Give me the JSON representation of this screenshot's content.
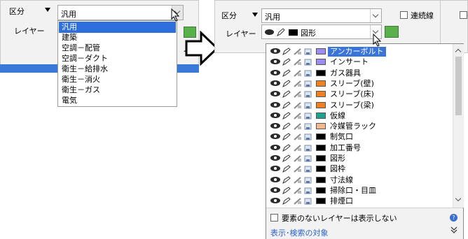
{
  "left": {
    "category_label": "区分",
    "layer_label": "レイヤー",
    "category_value": "汎用",
    "category_options": [
      "汎用",
      "建築",
      "空調－配管",
      "空調－ダクト",
      "衛生－給排水",
      "衛生－消火",
      "衛生－ガス",
      "電気"
    ],
    "selected_index": 0
  },
  "right": {
    "category_label": "区分",
    "category_value": "汎用",
    "layer_label": "レイヤー",
    "layer_value": "図形",
    "continuous_line_label": "連続線",
    "layers": [
      {
        "name": "アンカーボルト",
        "color": "#9b8ef0",
        "selected": true
      },
      {
        "name": "インサート",
        "color": "#9b8ef0",
        "selected": false
      },
      {
        "name": "ガス器具",
        "color": "#000000",
        "selected": false
      },
      {
        "name": "スリーブ(壁)",
        "color": "#f08020",
        "selected": false
      },
      {
        "name": "スリーブ(床)",
        "color": "#f08020",
        "selected": false
      },
      {
        "name": "スリーブ(梁)",
        "color": "#f08020",
        "selected": false
      },
      {
        "name": "仮線",
        "color": "#20a090",
        "selected": false
      },
      {
        "name": "冷媒管ラック",
        "color": "#f4b890",
        "selected": false
      },
      {
        "name": "制気口",
        "color": "#000000",
        "selected": false
      },
      {
        "name": "加工番号",
        "color": "#000000",
        "selected": false
      },
      {
        "name": "図形",
        "color": "#000000",
        "selected": false
      },
      {
        "name": "図枠",
        "color": "#000000",
        "selected": false
      },
      {
        "name": "寸法線",
        "color": "#000000",
        "selected": false
      },
      {
        "name": "掃除口・目皿",
        "color": "#000000",
        "selected": false
      },
      {
        "name": "排煙口",
        "color": "#000000",
        "selected": false
      }
    ],
    "hide_empty_label": "要素のないレイヤーは表示しない",
    "display_search_label": "表示･検索の対象"
  },
  "colors": {
    "accent": "#3b79d8",
    "selection": "#2f6fdd",
    "panel": "#f2f2f2"
  }
}
